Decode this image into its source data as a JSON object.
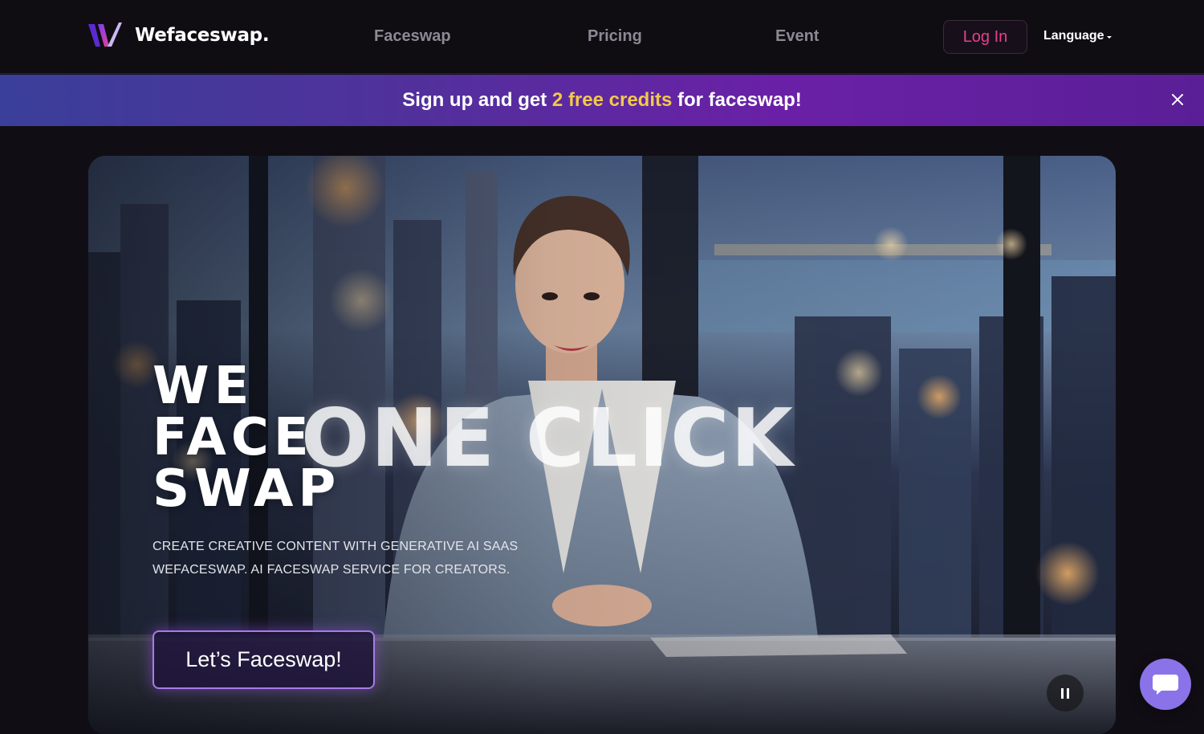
{
  "header": {
    "logo_text": "Wefaceswap.",
    "nav": [
      "Faceswap",
      "Pricing",
      "Event"
    ],
    "login_label": "Log In",
    "language_label": "Language"
  },
  "banner": {
    "text_before": "Sign up and get ",
    "highlight": "2 free credits",
    "text_after": " for faceswap!",
    "highlight_color": "#f2c94c"
  },
  "hero": {
    "title_lines": [
      "WE",
      "FACE",
      "SWAP"
    ],
    "overlay_text": "ONE CLICK",
    "subtitle_line1": "CREATE CREATIVE CONTENT WITH GENERATIVE AI SAAS",
    "subtitle_line2": "WEFACESWAP. AI FACESWAP SERVICE FOR CREATORS.",
    "cta_label": "Let’s Faceswap!"
  },
  "colors": {
    "login_text": "#e5408e",
    "cta_border": "#a97be6",
    "chat_button": "#8a73e8"
  },
  "icons": {
    "logo": "w-logo-icon",
    "close": "close-icon",
    "pause": "pause-icon",
    "chat": "chat-bubble-icon",
    "language_caret": "caret-down-icon"
  }
}
